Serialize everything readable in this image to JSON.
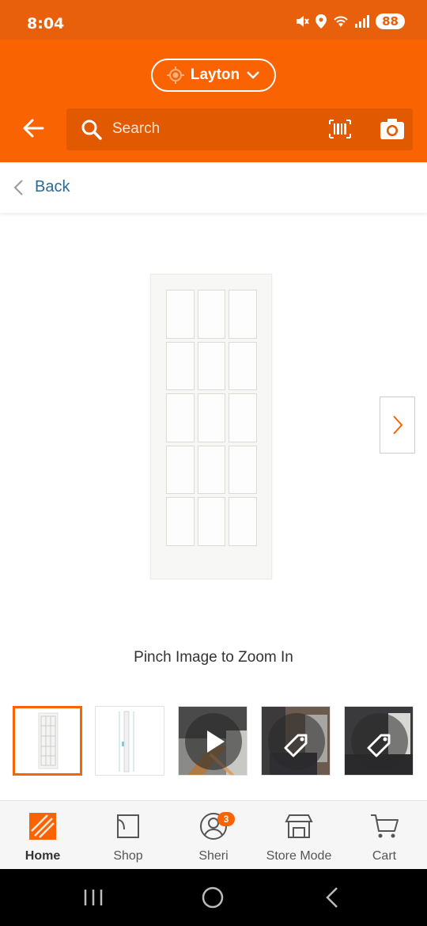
{
  "status_bar": {
    "time": "8:04",
    "battery": "88"
  },
  "header": {
    "location": "Layton",
    "search_placeholder": "Search"
  },
  "back_bar": {
    "label": "Back"
  },
  "product": {
    "zoom_hint": "Pinch Image to Zoom In"
  },
  "thumbnails": [
    {
      "name": "door-front",
      "selected": true
    },
    {
      "name": "door-dimensions",
      "selected": false
    },
    {
      "name": "video",
      "selected": false
    },
    {
      "name": "room-photo-1",
      "selected": false
    },
    {
      "name": "room-photo-2",
      "selected": false
    }
  ],
  "tab_bar": {
    "items": [
      {
        "label": "Home",
        "icon": "home-depot-logo-icon"
      },
      {
        "label": "Shop",
        "icon": "paint-bucket-icon"
      },
      {
        "label": "Sheri",
        "icon": "user-icon",
        "badge": "3"
      },
      {
        "label": "Store Mode",
        "icon": "store-icon"
      },
      {
        "label": "Cart",
        "icon": "cart-icon"
      }
    ]
  },
  "colors": {
    "brand": "#f96302",
    "link": "#2c6a94"
  }
}
